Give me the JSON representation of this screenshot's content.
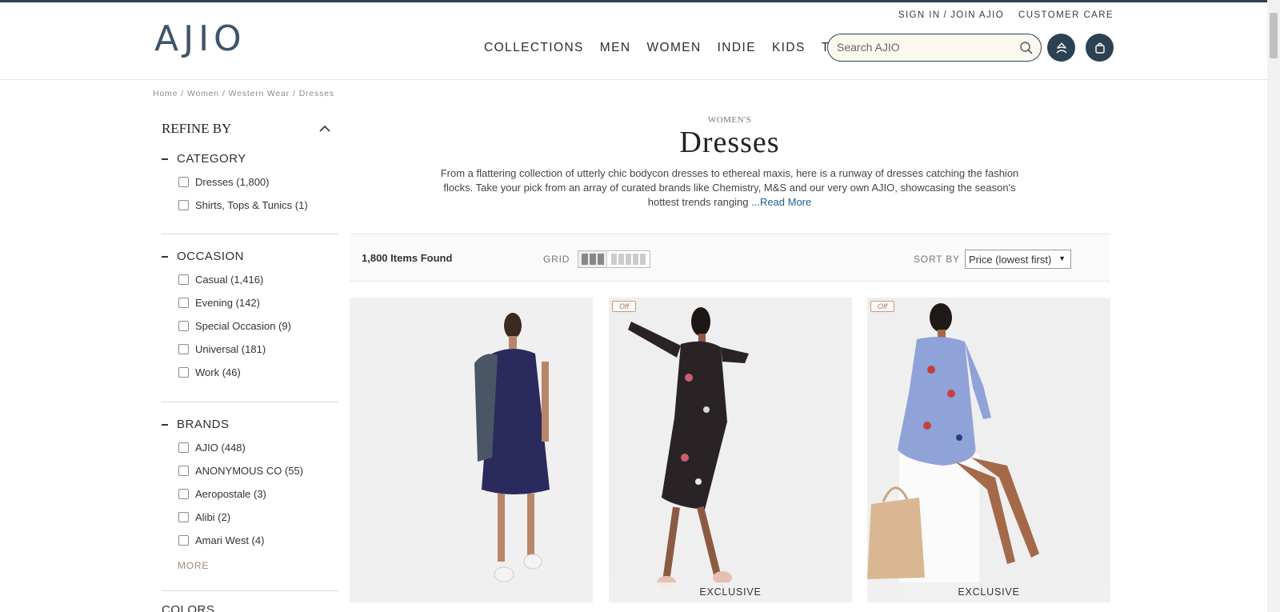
{
  "brand": {
    "logo_text": "AJIO",
    "accent": "#2c4152"
  },
  "util_links": {
    "sign_in": "SIGN IN",
    "sep": "/",
    "join": "JOIN AJIO",
    "customer_care": "CUSTOMER CARE"
  },
  "nav": {
    "items": [
      "COLLECTIONS",
      "MEN",
      "WOMEN",
      "INDIE",
      "KIDS",
      "TECH"
    ]
  },
  "search": {
    "placeholder": "Search AJIO",
    "value": ""
  },
  "header_icons": {
    "search": "search-icon",
    "account": "user-icon",
    "bag": "bag-icon"
  },
  "breadcrumb": [
    "Home",
    "Women",
    "Western Wear",
    "Dresses"
  ],
  "sidebar": {
    "title": "REFINE BY",
    "category": {
      "label": "CATEGORY",
      "options": [
        "Dresses (1,800)",
        "Shirts, Tops & Tunics (1)"
      ]
    },
    "occasion": {
      "label": "OCCASION",
      "options": [
        "Casual (1,416)",
        "Evening (142)",
        "Special Occasion (9)",
        "Universal (181)",
        "Work (46)"
      ]
    },
    "brands": {
      "label": "BRANDS",
      "options": [
        "AJIO (448)",
        "ANONYMOUS CO (55)",
        "Aeropostale (3)",
        "Alibi (2)",
        "Amari West (4)"
      ],
      "more_label": "MORE"
    },
    "colors": {
      "label": "COLORS"
    }
  },
  "category_header": {
    "eyebrow": "WOMEN'S",
    "title": "Dresses",
    "description": "From a flattering collection of utterly chic bodycon dresses to ethereal maxis, here is a runway of dresses catching the fashion flocks. Take your pick from an array of curated brands like Chemistry, M&S and our very own AJIO, showcasing the season's hottest trends ranging ...",
    "read_more": "Read More"
  },
  "toolbar": {
    "items_found": "1,800 Items Found",
    "grid_label": "GRID",
    "sort_label": "SORT BY",
    "sort_value": "Price (lowest first)"
  },
  "products": [
    {
      "off_tag": "",
      "badge": ""
    },
    {
      "off_tag": "Off",
      "badge": "EXCLUSIVE"
    },
    {
      "off_tag": "Off",
      "badge": "EXCLUSIVE"
    }
  ]
}
